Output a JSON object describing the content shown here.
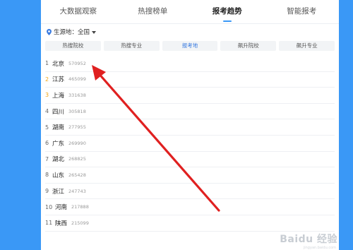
{
  "tabs": [
    "大数据观察",
    "热搜榜单",
    "报考趋势",
    "智能报考"
  ],
  "active_tab": 2,
  "filter": {
    "label": "生源地：全国"
  },
  "subtabs": [
    "热搜院校",
    "热搜专业",
    "报考地",
    "飙升院校",
    "飙升专业"
  ],
  "active_subtab": 2,
  "rows": [
    {
      "rank": "1",
      "name": "北京",
      "value": "570952"
    },
    {
      "rank": "2",
      "name": "江苏",
      "value": "465099"
    },
    {
      "rank": "3",
      "name": "上海",
      "value": "331638"
    },
    {
      "rank": "4",
      "name": "四川",
      "value": "305818"
    },
    {
      "rank": "5",
      "name": "湖南",
      "value": "277955"
    },
    {
      "rank": "6",
      "name": "广东",
      "value": "269990"
    },
    {
      "rank": "7",
      "name": "湖北",
      "value": "268825"
    },
    {
      "rank": "8",
      "name": "山东",
      "value": "265428"
    },
    {
      "rank": "9",
      "name": "浙江",
      "value": "247743"
    },
    {
      "rank": "10",
      "name": "河南",
      "value": "217888"
    },
    {
      "rank": "11",
      "name": "陕西",
      "value": "215099"
    }
  ],
  "watermark": {
    "text": "Baidu 经验",
    "url": "jingyan.baidu.com"
  },
  "colors": {
    "accent": "#3a98f6",
    "arrow": "#e02020",
    "rank_highlight": "#f3a512"
  }
}
